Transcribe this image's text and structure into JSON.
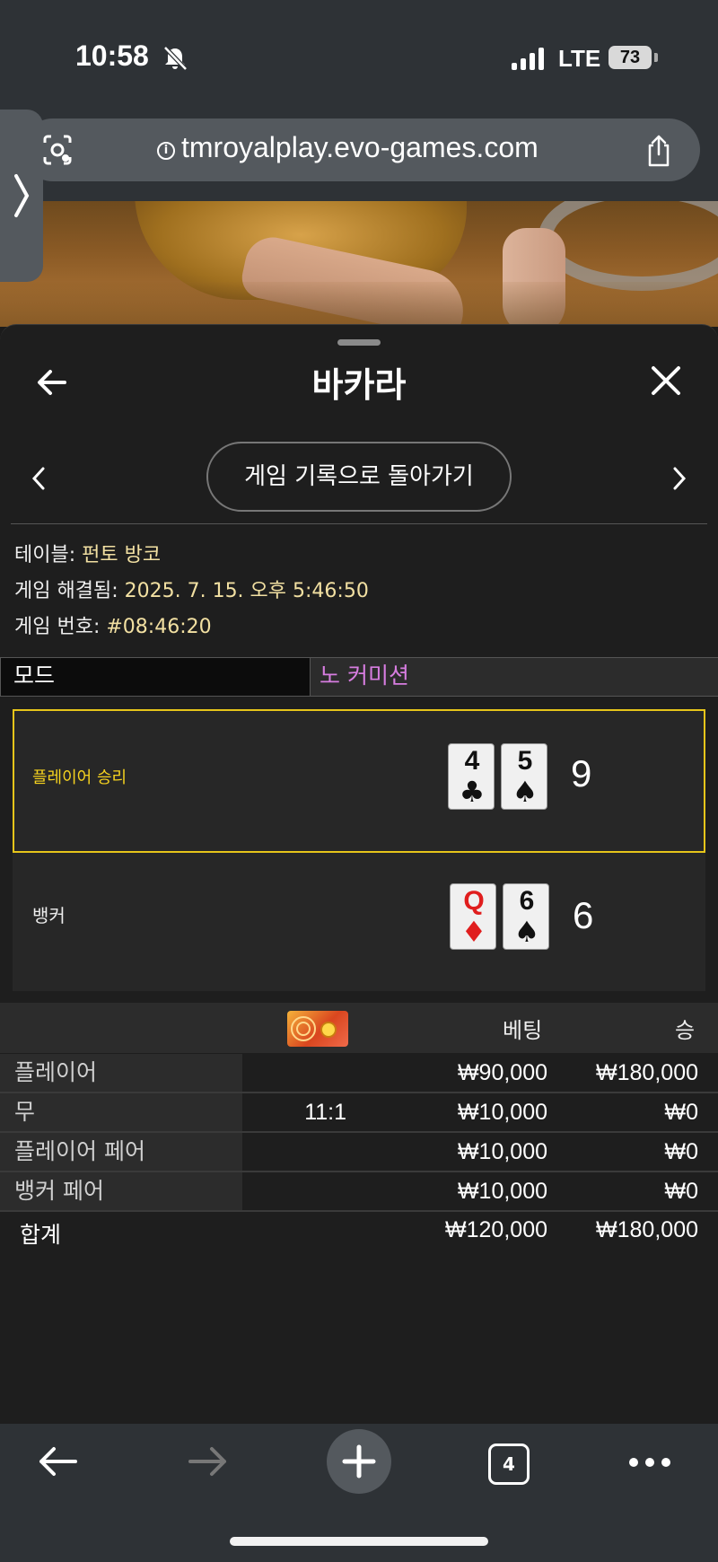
{
  "status": {
    "time": "10:58",
    "network": "LTE",
    "battery": "73"
  },
  "browser": {
    "url": "tmroyalplay.evo-games.com",
    "tab_count": "4"
  },
  "modal": {
    "title": "바카라",
    "back_to_history": "게임 기록으로 돌아가기"
  },
  "info": {
    "table_label": "테이블: ",
    "table_value": "펀토 방코",
    "resolved_label": "게임 해결됨: ",
    "resolved_value": "2025. 7. 15. 오후 5:46:50",
    "number_label": "게임 번호: ",
    "number_value": "#08:46:20"
  },
  "mode": {
    "label": "모드",
    "value": "노 커미션"
  },
  "result": {
    "player": {
      "label": "플레이어 승리",
      "cards": [
        {
          "rank": "4",
          "suit": "♣"
        },
        {
          "rank": "5",
          "suit": "♠"
        }
      ],
      "score": "9"
    },
    "banker": {
      "label": "뱅커",
      "cards": [
        {
          "rank": "Q",
          "suit": "♦"
        },
        {
          "rank": "6",
          "suit": "♠"
        }
      ],
      "score": "6"
    }
  },
  "bets": {
    "header": {
      "bet": "베팅",
      "win": "승"
    },
    "rows": [
      {
        "label": "플레이어",
        "odds": "",
        "bet": "₩90,000",
        "win": "₩180,000"
      },
      {
        "label": "무",
        "odds": "11:1",
        "bet": "₩10,000",
        "win": "₩0"
      },
      {
        "label": "플레이어 페어",
        "odds": "",
        "bet": "₩10,000",
        "win": "₩0"
      },
      {
        "label": "뱅커 페어",
        "odds": "",
        "bet": "₩10,000",
        "win": "₩0"
      }
    ],
    "total": {
      "label": "합계",
      "bet": "₩120,000",
      "win": "₩180,000"
    }
  },
  "colors": {
    "winner_border": "#e6c51a",
    "mode_value": "#d77de0",
    "info_value": "#f2e0a2"
  },
  "icons": [
    "bell-off-icon",
    "signal-icon",
    "camera-search-icon",
    "info-icon",
    "share-icon",
    "chevron-right-icon",
    "back-arrow-icon",
    "close-icon",
    "chevron-left-icon",
    "forward-arrow-icon",
    "plus-icon",
    "tabs-icon",
    "more-icon"
  ]
}
